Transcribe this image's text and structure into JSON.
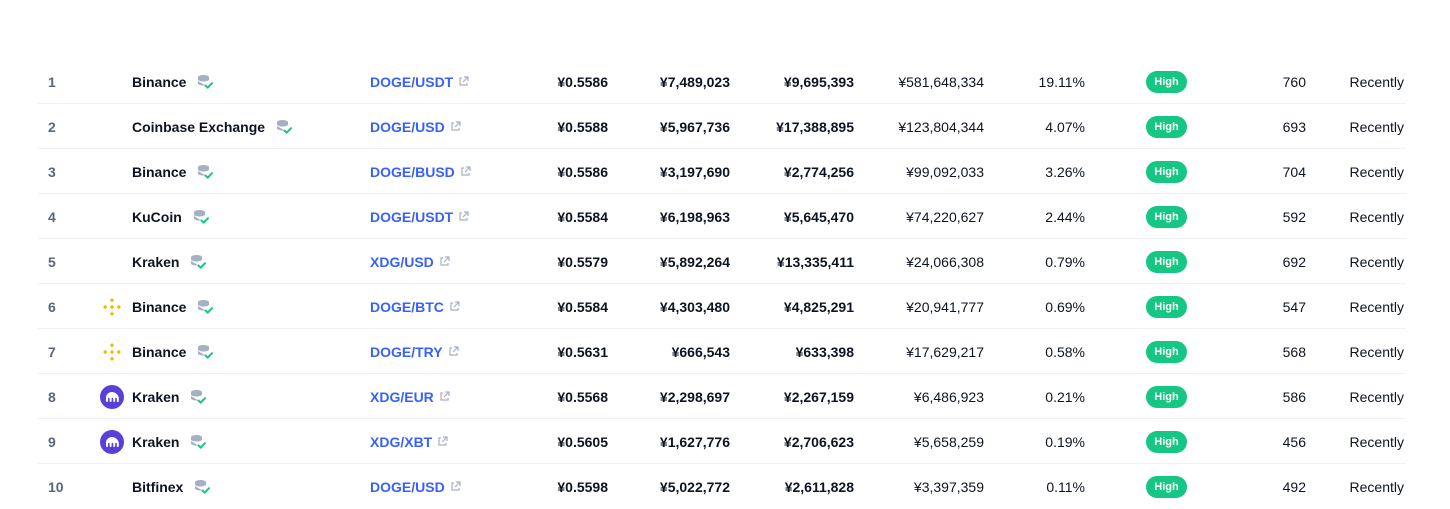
{
  "rows": [
    {
      "rank": "1",
      "logo": "none",
      "exchange": "Binance",
      "pair": "DOGE/USDT",
      "price": "¥0.5586",
      "depth_plus": "¥7,489,023",
      "depth_minus": "¥9,695,393",
      "volume": "¥581,648,334",
      "volume_pct": "19.11%",
      "confidence": "High",
      "liquidity": "760",
      "updated": "Recently"
    },
    {
      "rank": "2",
      "logo": "none",
      "exchange": "Coinbase Exchange",
      "pair": "DOGE/USD",
      "price": "¥0.5588",
      "depth_plus": "¥5,967,736",
      "depth_minus": "¥17,388,895",
      "volume": "¥123,804,344",
      "volume_pct": "4.07%",
      "confidence": "High",
      "liquidity": "693",
      "updated": "Recently"
    },
    {
      "rank": "3",
      "logo": "none",
      "exchange": "Binance",
      "pair": "DOGE/BUSD",
      "price": "¥0.5586",
      "depth_plus": "¥3,197,690",
      "depth_minus": "¥2,774,256",
      "volume": "¥99,092,033",
      "volume_pct": "3.26%",
      "confidence": "High",
      "liquidity": "704",
      "updated": "Recently"
    },
    {
      "rank": "4",
      "logo": "none",
      "exchange": "KuCoin",
      "pair": "DOGE/USDT",
      "price": "¥0.5584",
      "depth_plus": "¥6,198,963",
      "depth_minus": "¥5,645,470",
      "volume": "¥74,220,627",
      "volume_pct": "2.44%",
      "confidence": "High",
      "liquidity": "592",
      "updated": "Recently"
    },
    {
      "rank": "5",
      "logo": "none",
      "exchange": "Kraken",
      "pair": "XDG/USD",
      "price": "¥0.5579",
      "depth_plus": "¥5,892,264",
      "depth_minus": "¥13,335,411",
      "volume": "¥24,066,308",
      "volume_pct": "0.79%",
      "confidence": "High",
      "liquidity": "692",
      "updated": "Recently"
    },
    {
      "rank": "6",
      "logo": "binance-logo-icon",
      "exchange": "Binance",
      "pair": "DOGE/BTC",
      "price": "¥0.5584",
      "depth_plus": "¥4,303,480",
      "depth_minus": "¥4,825,291",
      "volume": "¥20,941,777",
      "volume_pct": "0.69%",
      "confidence": "High",
      "liquidity": "547",
      "updated": "Recently"
    },
    {
      "rank": "7",
      "logo": "binance-logo-icon",
      "exchange": "Binance",
      "pair": "DOGE/TRY",
      "price": "¥0.5631",
      "depth_plus": "¥666,543",
      "depth_minus": "¥633,398",
      "volume": "¥17,629,217",
      "volume_pct": "0.58%",
      "confidence": "High",
      "liquidity": "568",
      "updated": "Recently"
    },
    {
      "rank": "8",
      "logo": "kraken-logo-icon",
      "exchange": "Kraken",
      "pair": "XDG/EUR",
      "price": "¥0.5568",
      "depth_plus": "¥2,298,697",
      "depth_minus": "¥2,267,159",
      "volume": "¥6,486,923",
      "volume_pct": "0.21%",
      "confidence": "High",
      "liquidity": "586",
      "updated": "Recently"
    },
    {
      "rank": "9",
      "logo": "kraken-logo-icon",
      "exchange": "Kraken",
      "pair": "XDG/XBT",
      "price": "¥0.5605",
      "depth_plus": "¥1,627,776",
      "depth_minus": "¥2,706,623",
      "volume": "¥5,658,259",
      "volume_pct": "0.19%",
      "confidence": "High",
      "liquidity": "456",
      "updated": "Recently"
    },
    {
      "rank": "10",
      "logo": "none",
      "exchange": "Bitfinex",
      "pair": "DOGE/USD",
      "price": "¥0.5598",
      "depth_plus": "¥5,022,772",
      "depth_minus": "¥2,611,828",
      "volume": "¥3,397,359",
      "volume_pct": "0.11%",
      "confidence": "High",
      "liquidity": "492",
      "updated": "Recently"
    }
  ],
  "colors": {
    "link": "#3861fb",
    "badge_high": "#16c784",
    "verify_check": "#16c784",
    "binance_yellow": "#f0b90b",
    "kraken_purple": "#5841d8"
  }
}
